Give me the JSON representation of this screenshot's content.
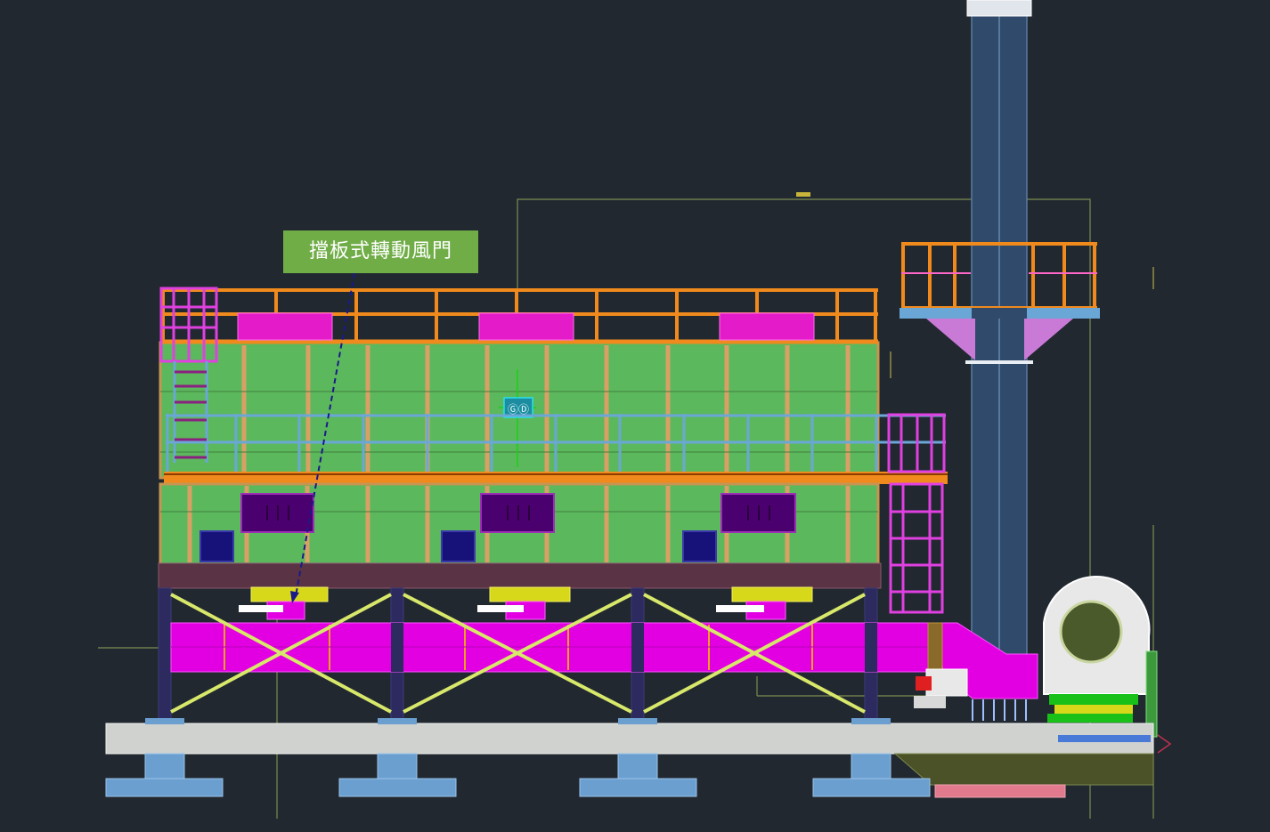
{
  "canvas": {
    "background": "#212830"
  },
  "callout": {
    "label": "擋板式轉動風門",
    "background": "#70ad47",
    "text_color": "#ffffff"
  },
  "tank_tag": "ⒼⒹ",
  "colors": {
    "body_green": "#5cb85c",
    "frame_tan": "#d9a066",
    "rail_orange": "#f08a1c",
    "magenta": "#e200e2",
    "dark_purple": "#4b0070",
    "navy_panel": "#17127a",
    "steel_blue": "#6aa7d6",
    "brace_yellow": "#d8e86a",
    "stack_blue": "#2f4a6a",
    "base_gray": "#cfd2cf",
    "foot_blue": "#6b9fd0"
  }
}
